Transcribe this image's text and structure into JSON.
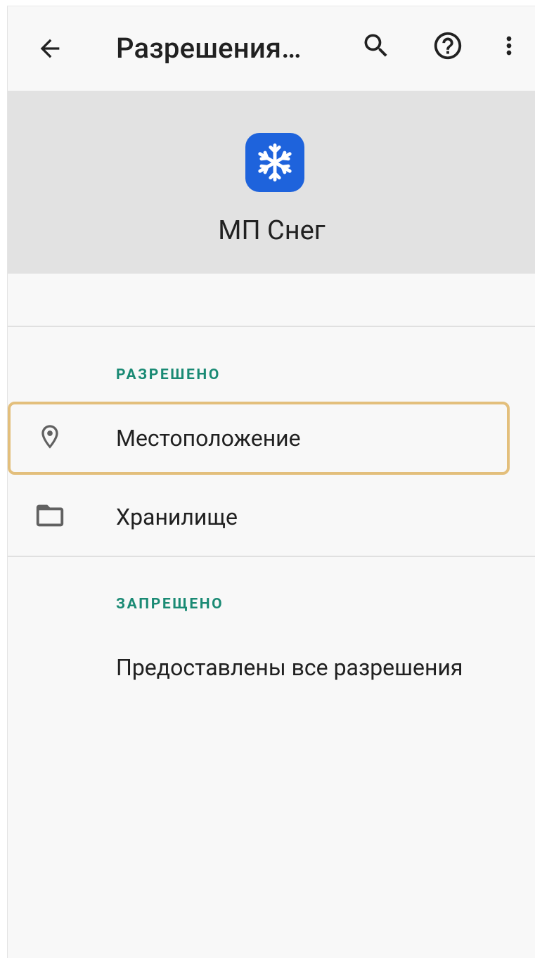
{
  "toolbar": {
    "back_icon": "arrow-back-icon",
    "title": "Разрешения…",
    "search_icon": "search-icon",
    "help_icon": "help-circle-icon",
    "more_icon": "more-vert-icon"
  },
  "app": {
    "name": "МП Снег",
    "icon": "snowflake-icon",
    "icon_color": "#1e63dc"
  },
  "allowed": {
    "header": "РАЗРЕШЕНО",
    "items": [
      {
        "label": "Местоположение",
        "icon": "location-pin-icon",
        "highlighted": true
      },
      {
        "label": "Хранилище",
        "icon": "folder-icon",
        "highlighted": false
      }
    ]
  },
  "denied": {
    "header": "ЗАПРЕЩЕНО",
    "empty_text": "Предоставлены все разрешения"
  },
  "colors": {
    "accent": "#1a8a74",
    "highlight": "#e3bf7c",
    "header_bg": "#e2e2e2"
  }
}
